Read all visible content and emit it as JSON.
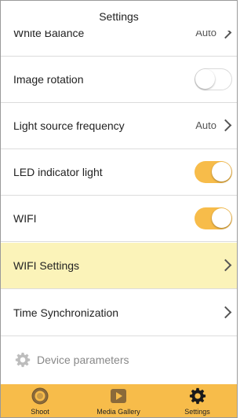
{
  "header": {
    "title": "Settings"
  },
  "rows": {
    "white_balance": {
      "label": "White Balance",
      "value": "Auto"
    },
    "image_rotation": {
      "label": "Image rotation",
      "toggle": "off"
    },
    "light_freq": {
      "label": "Light source frequency",
      "value": "Auto"
    },
    "led": {
      "label": "LED indicator light",
      "toggle": "on"
    },
    "wifi": {
      "label": "WIFI",
      "toggle": "on"
    },
    "wifi_settings": {
      "label": "WIFI Settings"
    },
    "time_sync": {
      "label": "Time Synchronization"
    },
    "device": {
      "label": "Device parameters"
    }
  },
  "tabs": [
    {
      "label": "Shoot",
      "icon": "shoot-icon"
    },
    {
      "label": "Media Gallery",
      "icon": "media-gallery-icon"
    },
    {
      "label": "Settings",
      "icon": "settings-gear-icon"
    }
  ],
  "colors": {
    "accent": "#f7bc4a",
    "highlight": "#fbf3b9",
    "divider": "#dcdcdc"
  }
}
